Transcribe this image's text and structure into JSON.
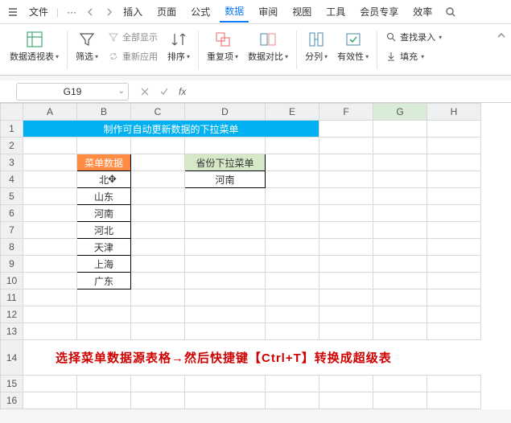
{
  "menubar": {
    "file": "文件",
    "more": "···",
    "tabs": [
      "插入",
      "页面",
      "公式",
      "数据",
      "审阅",
      "视图",
      "工具",
      "会员专享",
      "效率"
    ],
    "active_tab_index": 3
  },
  "ribbon": {
    "pivot": "数据透视表",
    "filter": "筛选",
    "show_all": "全部显示",
    "reapply": "重新应用",
    "sort": "排序",
    "duplicates": "重复项",
    "compare": "数据对比",
    "text_to_cols": "分列",
    "validation": "有效性",
    "find_entry": "查找录入",
    "fill": "填充"
  },
  "formula_bar": {
    "namebox": "G19",
    "fx": "fx",
    "value": ""
  },
  "grid": {
    "columns": [
      "A",
      "B",
      "C",
      "D",
      "E",
      "F",
      "G",
      "H"
    ],
    "selected_col": "G",
    "row_count": 16,
    "title_text": "制作可自动更新数据的下拉菜单",
    "menu_header": "菜单数据",
    "menu_items": [
      "北",
      "山东",
      "河南",
      "河北",
      "天津",
      "上海",
      "广东"
    ],
    "cursor_glyph": "✥",
    "prov_header": "省份下拉菜单",
    "prov_value": "河南"
  },
  "annotation": "选择菜单数据源表格→然后快捷键【Ctrl+T】转换成超级表"
}
